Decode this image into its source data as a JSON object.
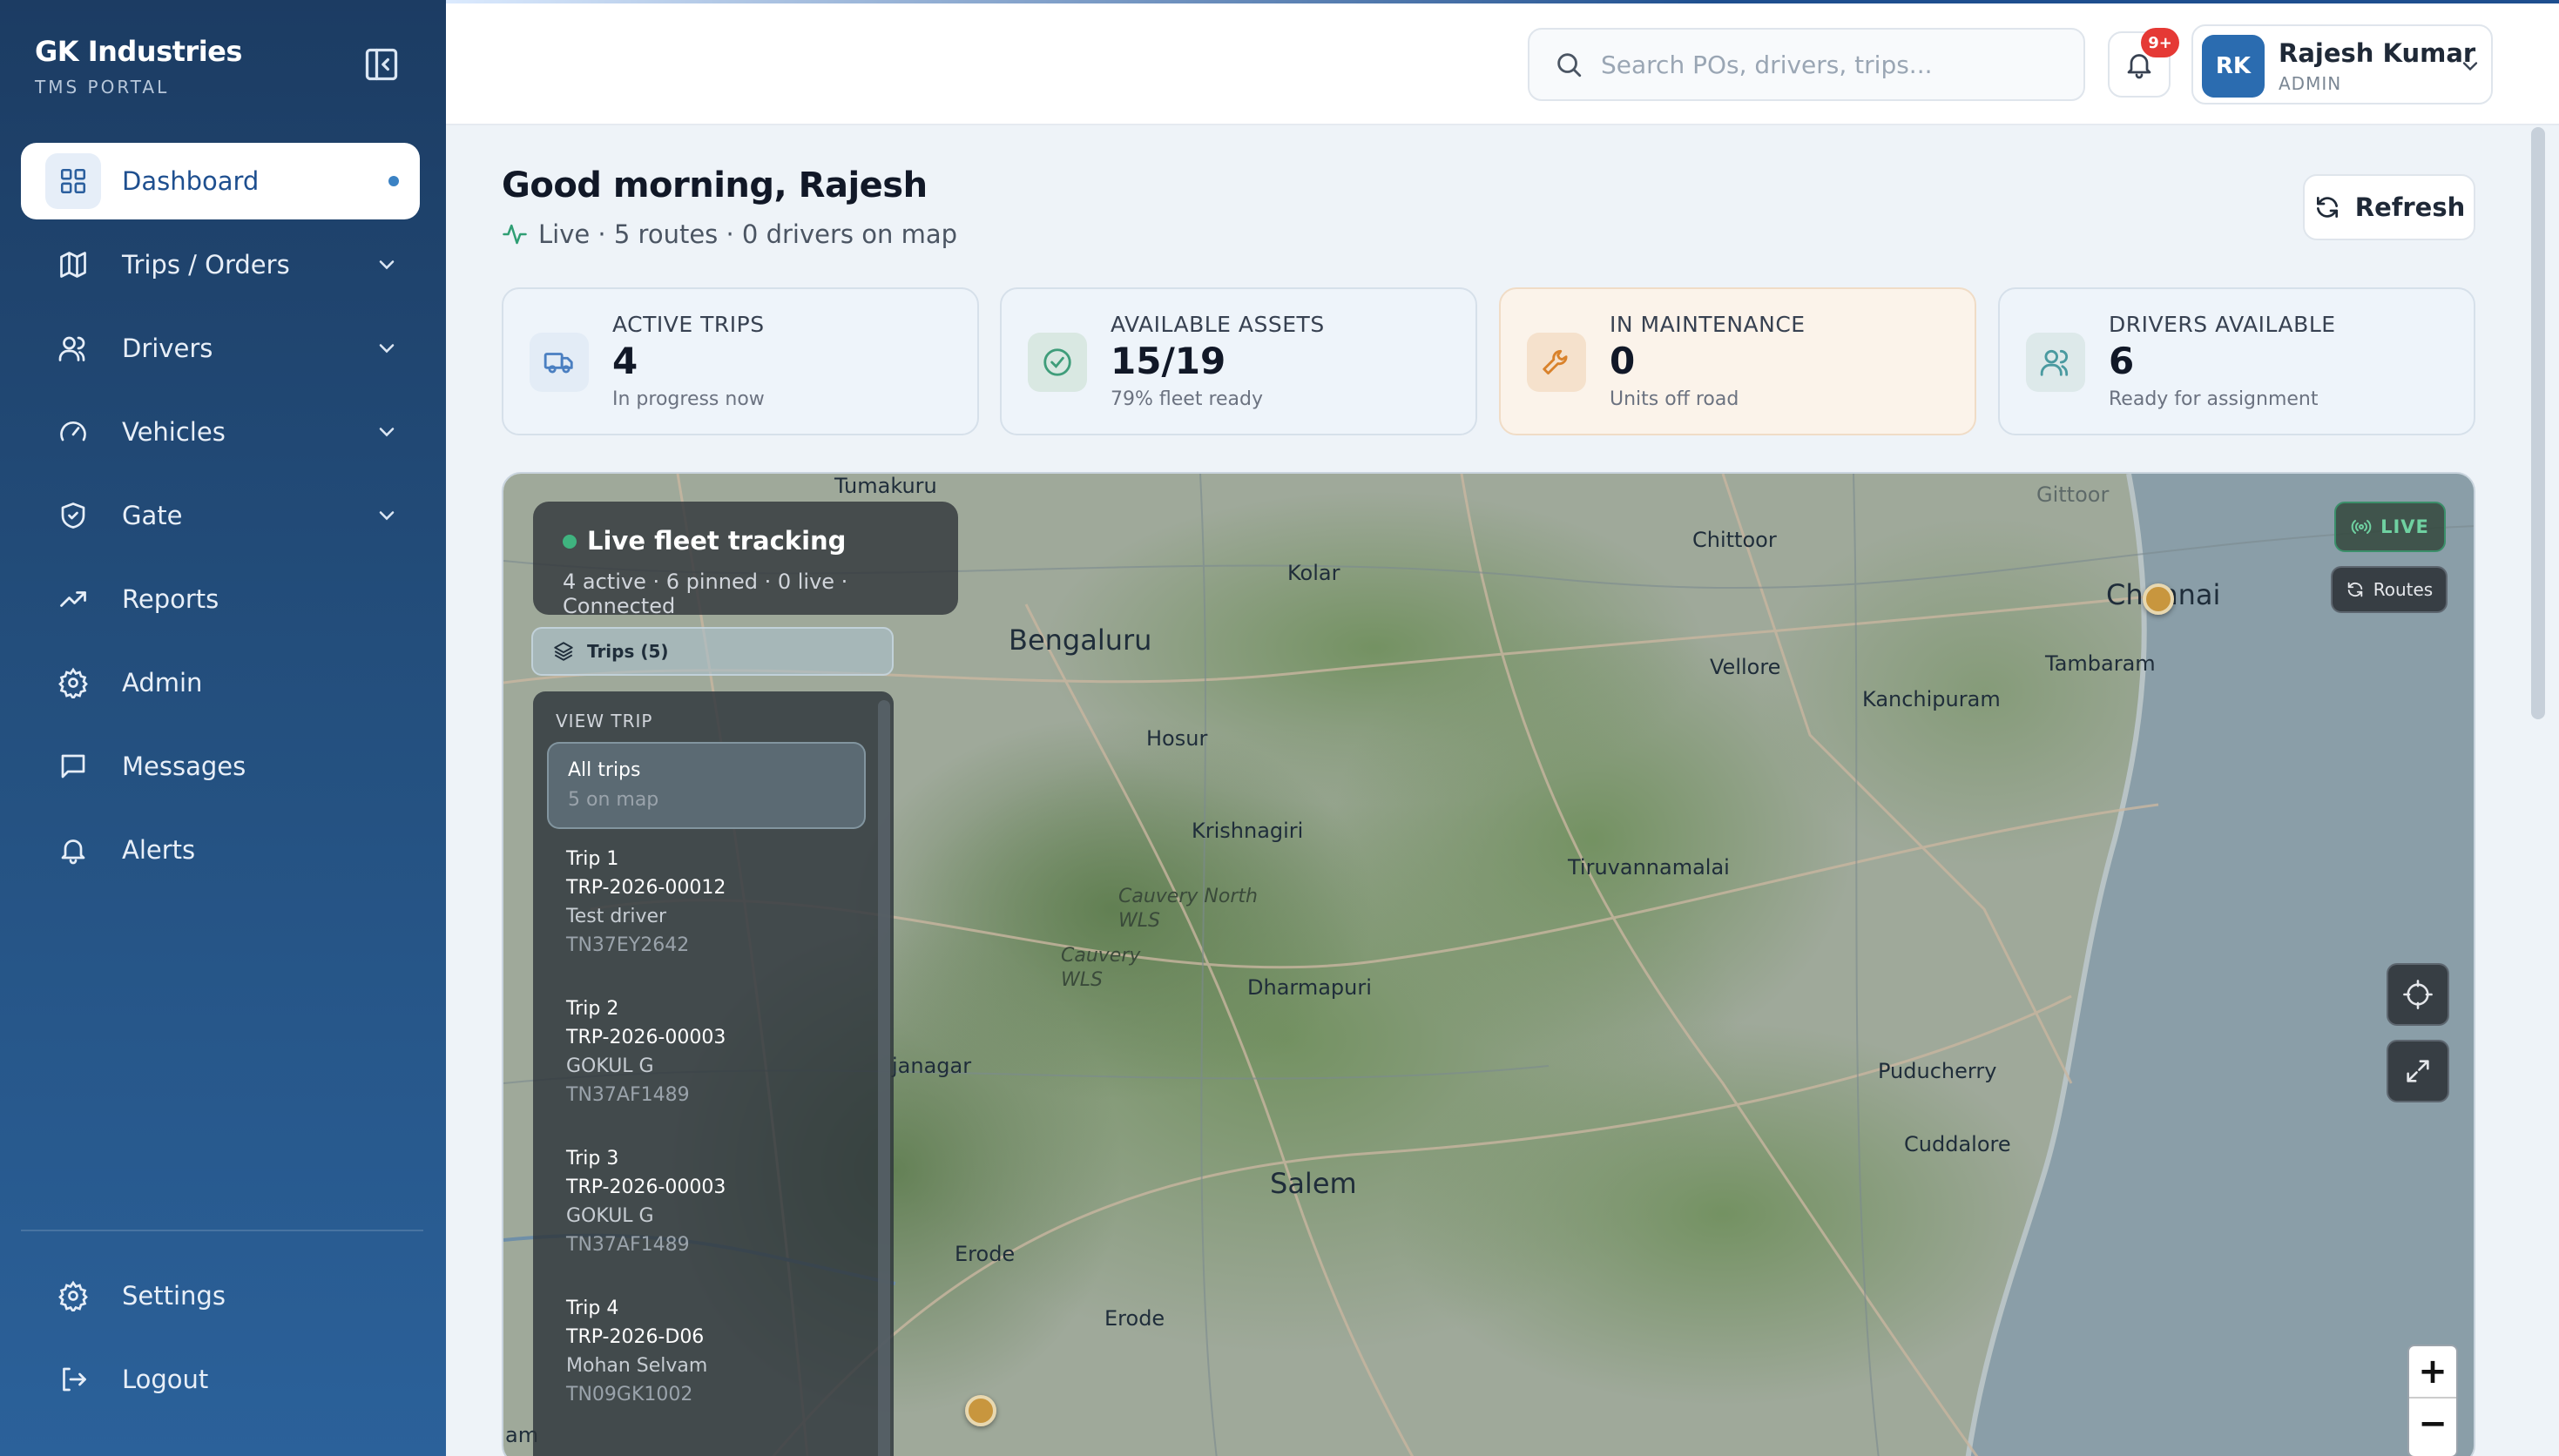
{
  "brand": {
    "name": "GK Industries",
    "subtitle": "TMS PORTAL"
  },
  "nav": [
    {
      "label": "Dashboard",
      "icon": "grid-icon",
      "active": true
    },
    {
      "label": "Trips / Orders",
      "icon": "map-icon",
      "expandable": true
    },
    {
      "label": "Drivers",
      "icon": "users-icon",
      "expandable": true
    },
    {
      "label": "Vehicles",
      "icon": "gauge-icon",
      "expandable": true
    },
    {
      "label": "Gate",
      "icon": "shield-icon",
      "expandable": true
    },
    {
      "label": "Reports",
      "icon": "trending-up-icon"
    },
    {
      "label": "Admin",
      "icon": "gear-icon"
    },
    {
      "label": "Messages",
      "icon": "message-icon"
    },
    {
      "label": "Alerts",
      "icon": "bell-icon"
    }
  ],
  "nav_bottom": [
    {
      "label": "Settings",
      "icon": "gear-icon"
    },
    {
      "label": "Logout",
      "icon": "logout-icon"
    }
  ],
  "header": {
    "search_placeholder": "Search POs, drivers, trips...",
    "notification_badge": "9+",
    "user": {
      "initials": "RK",
      "name": "Rajesh Kumar",
      "role": "ADMIN"
    }
  },
  "main": {
    "greeting": "Good morning, Rajesh",
    "subline": "Live · 5 routes · 0 drivers on map",
    "refresh_label": "Refresh"
  },
  "stats": [
    {
      "label": "ACTIVE TRIPS",
      "value": "4",
      "sub": "In progress now",
      "icon": "truck-icon",
      "color": "#4a7fc1"
    },
    {
      "label": "AVAILABLE ASSETS",
      "value": "15/19",
      "sub": "79% fleet ready",
      "icon": "check-circle-icon",
      "color": "#3f9d7a"
    },
    {
      "label": "IN MAINTENANCE",
      "value": "0",
      "sub": "Units off road",
      "icon": "wrench-icon",
      "color": "#d9822b"
    },
    {
      "label": "DRIVERS AVAILABLE",
      "value": "6",
      "sub": "Ready for assignment",
      "icon": "users-icon",
      "color": "#4a9aa0"
    }
  ],
  "map": {
    "tracking_title": "Live fleet tracking",
    "tracking_sub": "4 active · 6 pinned · 0 live · Connected",
    "trips_toggle": "Trips (5)",
    "view_trip_label": "VIEW TRIP",
    "all_trips": {
      "title": "All trips",
      "sub": "5 on map"
    },
    "trips": [
      {
        "title": "Trip 1",
        "id": "TRP-2026-00012",
        "driver": "Test driver",
        "vehicle": "TN37EY2642"
      },
      {
        "title": "Trip 2",
        "id": "TRP-2026-00003",
        "driver": "GOKUL G",
        "vehicle": "TN37AF1489"
      },
      {
        "title": "Trip 3",
        "id": "TRP-2026-00003",
        "driver": "GOKUL G",
        "vehicle": "TN37AF1489"
      },
      {
        "title": "Trip 4",
        "id": "TRP-2026-D06",
        "driver": "Mohan Selvam",
        "vehicle": "TN09GK1002"
      }
    ],
    "live_label": "LIVE",
    "routes_label": "Routes",
    "cities": [
      {
        "name": "Tumakuru",
        "size": "normal"
      },
      {
        "name": "Kolar",
        "size": "normal"
      },
      {
        "name": "Chittoor",
        "size": "normal"
      },
      {
        "name": "Bengaluru",
        "size": "big"
      },
      {
        "name": "Vellore",
        "size": "normal"
      },
      {
        "name": "Chennai",
        "size": "big"
      },
      {
        "name": "Tambaram",
        "size": "normal"
      },
      {
        "name": "Kanchipuram",
        "size": "normal"
      },
      {
        "name": "Hosur",
        "size": "normal"
      },
      {
        "name": "Krishnagiri",
        "size": "normal"
      },
      {
        "name": "Tiruvannamalai",
        "size": "normal"
      },
      {
        "name": "Cauvery North WLS",
        "size": "small"
      },
      {
        "name": "Cauvery WLS",
        "size": "small"
      },
      {
        "name": "Dharmapuri",
        "size": "normal"
      },
      {
        "name": "Puducherry",
        "size": "normal"
      },
      {
        "name": "Cuddalore",
        "size": "normal"
      },
      {
        "name": "Salem",
        "size": "big"
      },
      {
        "name": "Erode",
        "size": "normal"
      },
      {
        "name": "Erode",
        "size": "normal"
      },
      {
        "name": "janagar",
        "size": "normal"
      },
      {
        "name": "Gittoor",
        "size": "normal"
      },
      {
        "name": "am",
        "size": "normal"
      }
    ]
  },
  "zoom": {
    "in": "+",
    "out": "−"
  }
}
